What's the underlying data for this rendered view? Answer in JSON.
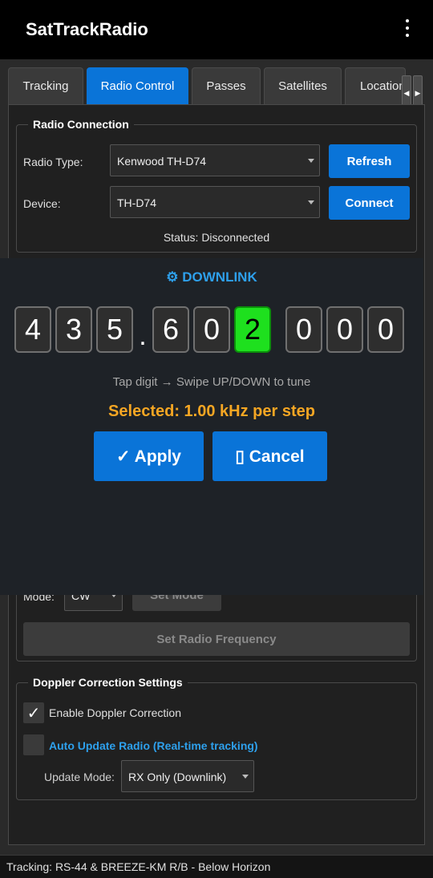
{
  "app": {
    "title": "SatTrackRadio"
  },
  "tabs": [
    {
      "label": "Tracking"
    },
    {
      "label": "Radio Control"
    },
    {
      "label": "Passes"
    },
    {
      "label": "Satellites"
    },
    {
      "label": "Location"
    }
  ],
  "radio_connection": {
    "title": "Radio Connection",
    "radio_type_label": "Radio Type:",
    "radio_type_value": "Kenwood TH-D74",
    "refresh_label": "Refresh",
    "device_label": "Device:",
    "device_value": "TH-D74",
    "connect_label": "Connect",
    "status": "Status: Disconnected"
  },
  "tuner": {
    "header_icon": "⚙",
    "header": "DOWNLINK",
    "digits": [
      "4",
      "3",
      "5",
      ".",
      "6",
      "0",
      "2",
      "0",
      "0",
      "0"
    ],
    "selected_index": 6,
    "hint": "Tap digit → Swipe UP/DOWN to tune",
    "selected_step": "Selected: 1.00 kHz per step",
    "apply_label": "✓ Apply",
    "cancel_label": "▯ Cancel"
  },
  "radio_controls": {
    "mode_label": "Mode:",
    "mode_value": "CW",
    "set_mode_label": "Set Mode",
    "set_frequency_label": "Set Radio Frequency"
  },
  "doppler": {
    "title": "Doppler Correction Settings",
    "enable_label": "Enable Doppler Correction",
    "enable_checked": true,
    "auto_update_label": "Auto Update Radio (Real-time tracking)",
    "auto_update_checked": false,
    "update_mode_label": "Update Mode:",
    "update_mode_value": "RX Only (Downlink)"
  },
  "status_bar": {
    "text": "Tracking: RS-44 & BREEZE-KM R/B - Below Horizon"
  },
  "colors": {
    "accent": "#0a74d8",
    "selected_digit": "#1ee01e",
    "step_text": "#f5a623",
    "link_text": "#2ea0ec"
  }
}
